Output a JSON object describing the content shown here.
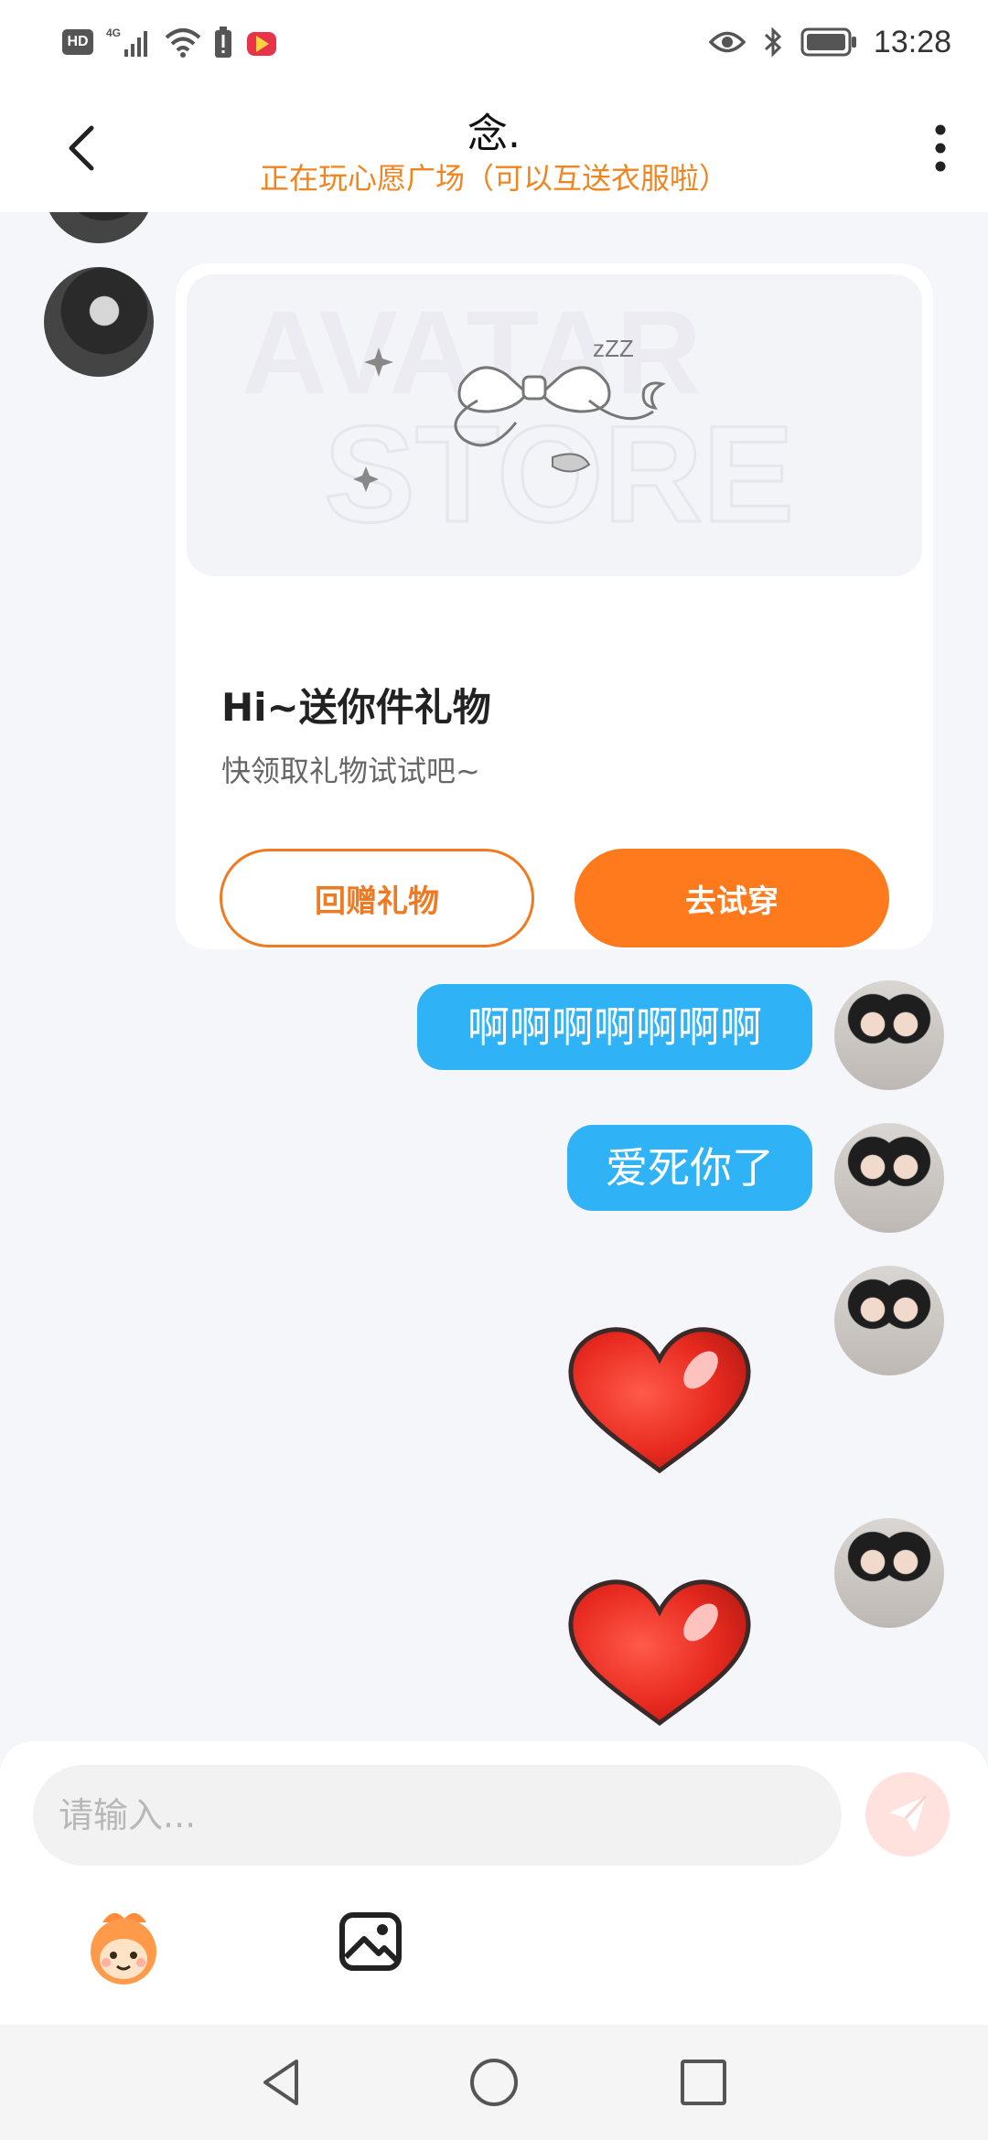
{
  "status_bar": {
    "time": "13:28",
    "hd_label": "HD",
    "network_label": "4G",
    "left_icons": [
      "hd-icon",
      "signal-icon",
      "wifi-icon",
      "battery-alert-icon",
      "app-notification-icon"
    ],
    "right_icons": [
      "eye-icon",
      "bluetooth-icon",
      "battery-icon"
    ]
  },
  "header": {
    "title": "念.",
    "subtitle": "正在玩心愿广场（可以互送衣服啦）"
  },
  "gift_card": {
    "title": "Hi~送你件礼物",
    "description": "快领取礼物试试吧~",
    "return_gift_label": "回赠礼物",
    "try_on_label": "去试穿",
    "banner_watermark_line1": "AVATAR",
    "banner_watermark_line2": "STORE"
  },
  "messages": [
    {
      "type": "text",
      "sender": "self",
      "text": "啊啊啊啊啊啊啊"
    },
    {
      "type": "text",
      "sender": "self",
      "text": "爱死你了"
    },
    {
      "type": "sticker",
      "sender": "self",
      "sticker": "heart-icon"
    },
    {
      "type": "sticker",
      "sender": "self",
      "sticker": "heart-icon"
    }
  ],
  "input": {
    "placeholder": "请输入..."
  },
  "colors": {
    "accent_orange": "#ff7a1c",
    "subtitle_orange": "#f08520",
    "bubble_blue": "#2fb2f6",
    "send_button_pink": "#ffe1de",
    "background": "#f4f6fa"
  }
}
